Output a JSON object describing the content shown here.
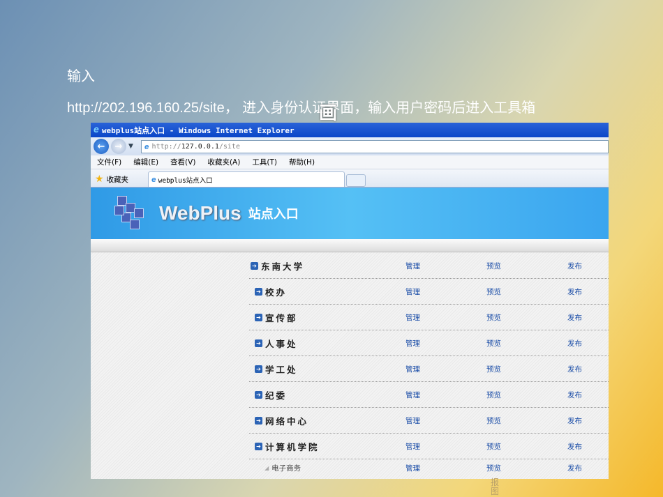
{
  "slide": {
    "line1": "输入",
    "line2": "http://202.196.160.25/site， 进入身份认证界面，输入用户密码后进入工具箱",
    "overlay_glyph": "画",
    "vertical_note": "报图"
  },
  "browser": {
    "title": "webplus站点入口 - Windows Internet Explorer",
    "url_prefix": "http://",
    "url_host": "127.0.0.1",
    "url_path": "/site",
    "menu": [
      "文件(F)",
      "编辑(E)",
      "查看(V)",
      "收藏夹(A)",
      "工具(T)",
      "帮助(H)"
    ],
    "favorites_label": "收藏夹",
    "tab_label": "webplus站点入口"
  },
  "banner": {
    "brand": "WebPlus",
    "subtitle": "站点入口"
  },
  "actions": {
    "manage": "管理",
    "preview": "预览",
    "publish": "发布"
  },
  "sites": [
    {
      "name": "东南大学"
    },
    {
      "name": "校办"
    },
    {
      "name": "宣传部"
    },
    {
      "name": "人事处"
    },
    {
      "name": "学工处"
    },
    {
      "name": "纪委"
    },
    {
      "name": "网络中心"
    },
    {
      "name": "计算机学院"
    }
  ],
  "subsites": [
    {
      "name": "电子商务"
    }
  ]
}
